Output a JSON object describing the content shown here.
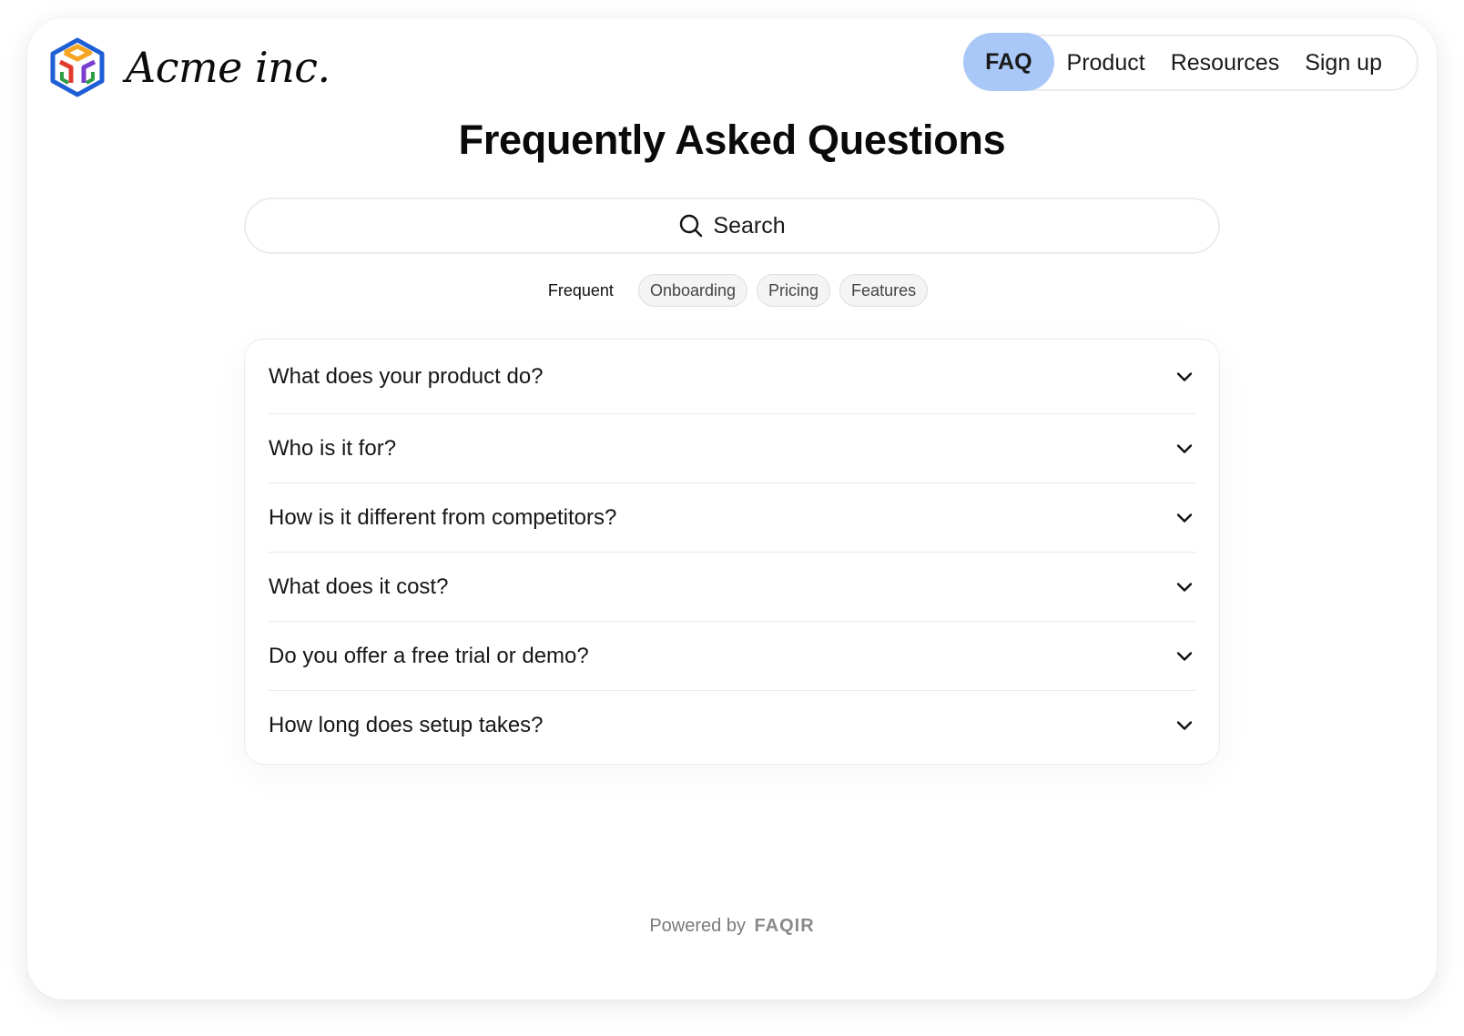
{
  "brand": {
    "name": "Acme inc.",
    "logo_icon": "cube-logo-icon",
    "logo_colors": [
      "#1f5fd6",
      "#f5a623",
      "#e23b2e",
      "#2f9e44",
      "#7b3fd0"
    ]
  },
  "nav": {
    "items": [
      {
        "label": "FAQ",
        "active": true
      },
      {
        "label": "Product",
        "active": false
      },
      {
        "label": "Resources",
        "active": false
      },
      {
        "label": "Sign up",
        "active": false
      }
    ],
    "active_color": "#a9c7f7"
  },
  "page": {
    "title": "Frequently Asked Questions"
  },
  "search": {
    "label": "Search",
    "icon": "search-icon"
  },
  "filters": [
    {
      "label": "Frequent",
      "active": true
    },
    {
      "label": "Onboarding",
      "active": false
    },
    {
      "label": "Pricing",
      "active": false
    },
    {
      "label": "Features",
      "active": false
    }
  ],
  "faq": {
    "items": [
      {
        "question": "What does your product do?"
      },
      {
        "question": "Who is it for?"
      },
      {
        "question": "How is it different from competitors?"
      },
      {
        "question": "What does it cost?"
      },
      {
        "question": "Do you offer a free trial or demo?"
      },
      {
        "question": "How long does setup takes?"
      }
    ],
    "expand_icon": "chevron-down-icon"
  },
  "footer": {
    "prefix": "Powered by",
    "brand": "FAQIR"
  }
}
